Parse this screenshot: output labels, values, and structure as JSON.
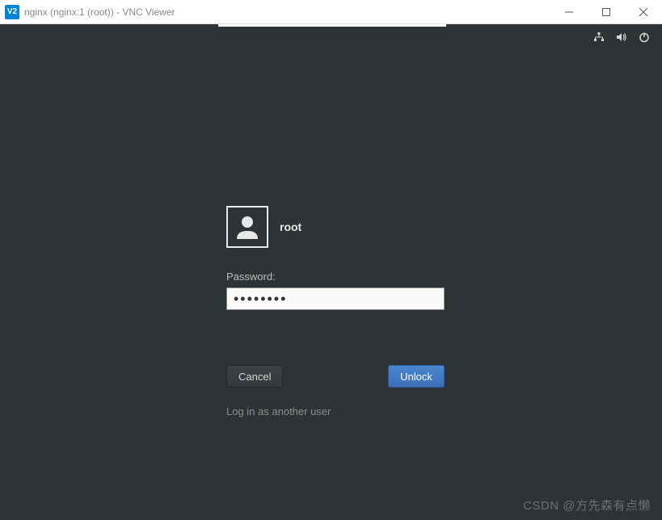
{
  "window": {
    "app_icon_text": "V2",
    "title": "nginx (nginx:1 (root)) - VNC Viewer"
  },
  "login": {
    "username": "root",
    "password_label": "Password:",
    "password_value": "••••••••",
    "cancel_label": "Cancel",
    "unlock_label": "Unlock",
    "another_user_label": "Log in as another user"
  },
  "watermark": "CSDN @方先森有点懒"
}
